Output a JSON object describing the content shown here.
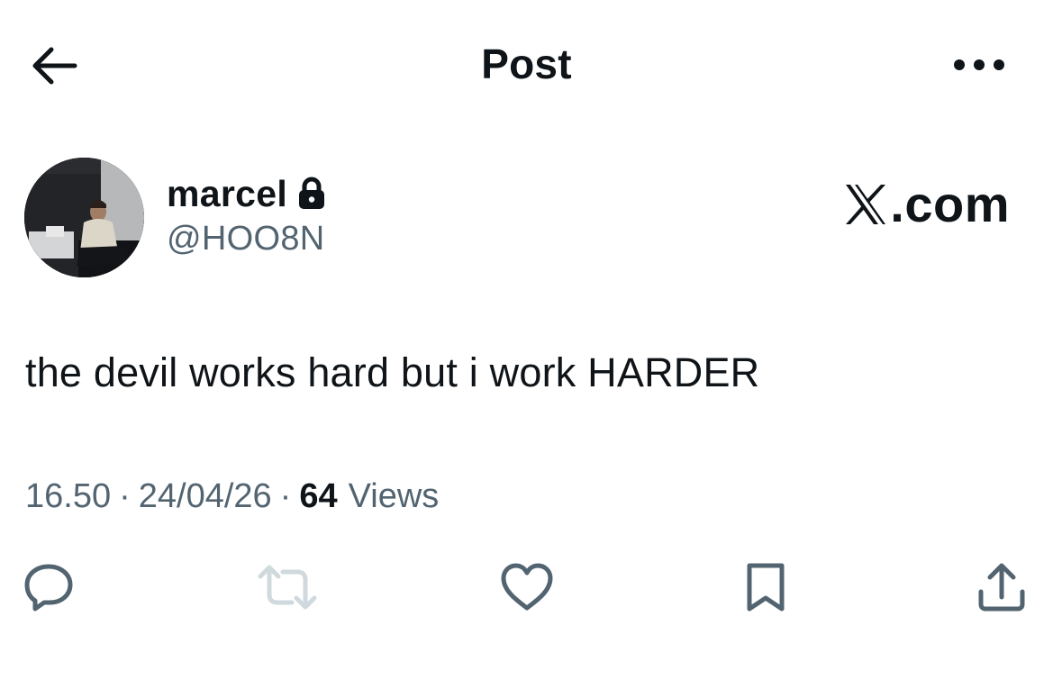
{
  "header": {
    "title": "Post",
    "back_icon": "arrow-left-icon",
    "more_icon": "more-horizontal-icon"
  },
  "author": {
    "name": "marcel",
    "handle": "@HOO8N",
    "protected_icon": "lock-icon"
  },
  "watermark": {
    "brand": "X",
    "text": ".com"
  },
  "post": {
    "text": "the devil works hard but i work HARDER"
  },
  "meta": {
    "time": "16.50",
    "separator": "·",
    "date": "24/04/26",
    "views_count": "64",
    "views_label": "Views"
  },
  "actions": [
    {
      "name": "reply",
      "icon": "reply-icon"
    },
    {
      "name": "repost",
      "icon": "repost-icon",
      "disabled": true
    },
    {
      "name": "like",
      "icon": "heart-icon"
    },
    {
      "name": "bookmark",
      "icon": "bookmark-icon"
    },
    {
      "name": "share",
      "icon": "share-icon"
    }
  ],
  "colors": {
    "text_primary": "#0f1419",
    "text_secondary": "#536471",
    "icon_disabled": "#cfd9de",
    "background": "#ffffff"
  }
}
